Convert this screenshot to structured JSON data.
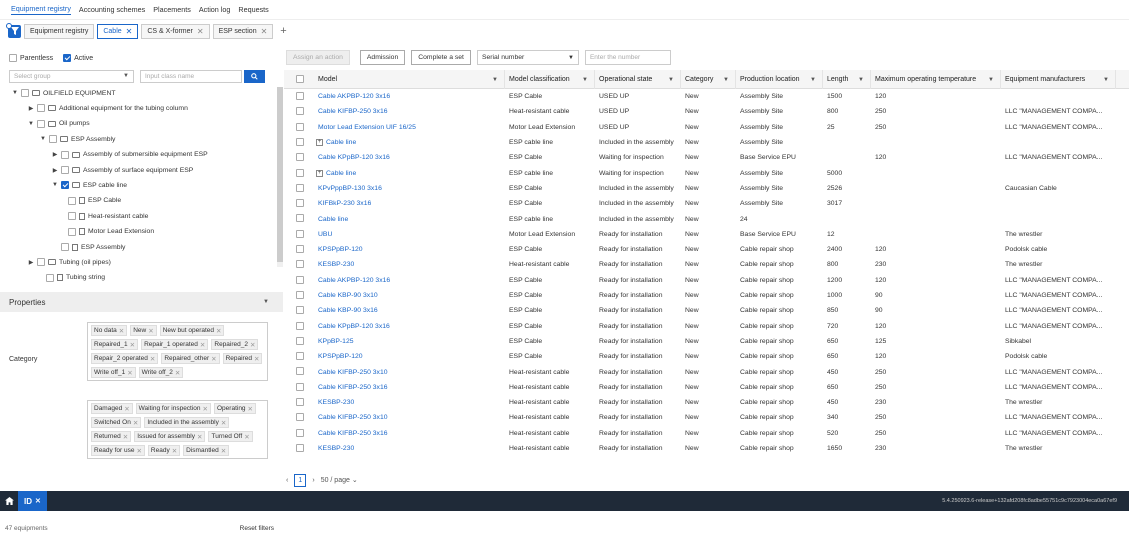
{
  "topnav": [
    "Equipment registry",
    "Accounting schemes",
    "Placements",
    "Action log",
    "Requests"
  ],
  "tabs": [
    {
      "label": "Equipment registry",
      "close": false,
      "active": false
    },
    {
      "label": "Cable",
      "close": true,
      "active": true
    },
    {
      "label": "CS & X-former",
      "close": true,
      "active": false
    },
    {
      "label": "ESP section",
      "close": true,
      "active": false
    }
  ],
  "filters": {
    "parentless": "Parentless",
    "active": "Active",
    "group_placeholder": "Select group",
    "class_placeholder": "Input class name"
  },
  "tree": [
    {
      "label": "OILFIELD EQUIPMENT",
      "level": 0,
      "caret": "▼",
      "checked": false,
      "icon": "folder"
    },
    {
      "label": "Additional equipment for the tubing column",
      "level": 1,
      "caret": "▶",
      "checked": false,
      "icon": "folder"
    },
    {
      "label": "Oil pumps",
      "level": 1,
      "caret": "▼",
      "checked": false,
      "icon": "folder"
    },
    {
      "label": "ESP Assembly",
      "level": 2,
      "caret": "▼",
      "checked": false,
      "icon": "folder"
    },
    {
      "label": "Assembly of submersible equipment ESP",
      "level": 3,
      "caret": "▶",
      "checked": false,
      "icon": "folder"
    },
    {
      "label": "Assembly of surface equipment ESP",
      "level": 3,
      "caret": "▶",
      "checked": false,
      "icon": "folder"
    },
    {
      "label": "ESP cable line",
      "level": 3,
      "caret": "▼",
      "checked": true,
      "icon": "folder"
    },
    {
      "label": "ESP Cable",
      "level": 4,
      "caret": "",
      "checked": false,
      "icon": "doc"
    },
    {
      "label": "Heat-resistant cable",
      "level": 4,
      "caret": "",
      "checked": false,
      "icon": "doc"
    },
    {
      "label": "Motor Lead Extension",
      "level": 4,
      "caret": "",
      "checked": false,
      "icon": "doc"
    },
    {
      "label": "ESP Assembly",
      "level": 2,
      "caret": "",
      "checked": false,
      "icon": "doc"
    },
    {
      "label": "Tubing (oil pipes)",
      "level": 0,
      "caret": "▶",
      "checked": false,
      "icon": "folder"
    },
    {
      "label": "Tubing string",
      "level": 0,
      "caret": "",
      "checked": false,
      "icon": "doc"
    }
  ],
  "properties": {
    "title": "Properties",
    "category_label": "Category",
    "category_tags": [
      "No data",
      "New",
      "New but operated",
      "Repaired_1",
      "Repair_1 operated",
      "Repaired_2",
      "Repair_2 operated",
      "Repaired_other",
      "Repaired",
      "Write off_1",
      "Write off_2"
    ],
    "state_tags": [
      "Damaged",
      "Waiting for inspection",
      "Operating",
      "Switched On",
      "Included in the assembly",
      "Returned",
      "Issued for assembly",
      "Turned Off",
      "Ready for use",
      "Ready",
      "Dismantled"
    ]
  },
  "left_footer": {
    "count": "47 equipments",
    "reset": "Reset filters"
  },
  "toolbar": {
    "assign": "Assign an action",
    "admission": "Admission",
    "complete": "Complete a set",
    "serial": "Serial number",
    "number_placeholder": "Enter the number"
  },
  "columns": [
    "Model",
    "Model classification",
    "Operational state",
    "Category",
    "Production location",
    "Length",
    "Maximum operating temperature",
    "Equipment manufacturers"
  ],
  "rows": [
    [
      "Cable AKPBP-120 3x16",
      "ESP Cable",
      "USED UP",
      "New",
      "Assembly Site",
      "1500",
      "120",
      ""
    ],
    [
      "Cable KIFBP-250 3x16",
      "Heat-resistant cable",
      "USED UP",
      "New",
      "Assembly Site",
      "800",
      "250",
      "LLC \"MANAGEMENT COMPA..."
    ],
    [
      "Motor Lead Extension UIF 16/25",
      "Motor Lead Extension",
      "USED UP",
      "New",
      "Assembly Site",
      "25",
      "250",
      "LLC \"MANAGEMENT COMPA..."
    ],
    [
      "Cable line",
      "ESP cable line",
      "Included in the assembly",
      "New",
      "Assembly Site",
      "",
      "",
      ""
    ],
    [
      "Cable KPpBP-120 3x16",
      "ESP Cable",
      "Waiting for inspection",
      "New",
      "Base Service EPU",
      "",
      "120",
      "LLC \"MANAGEMENT COMPA..."
    ],
    [
      "Cable line",
      "ESP cable line",
      "Waiting for inspection",
      "New",
      "Assembly Site",
      "5000",
      "",
      ""
    ],
    [
      "KPvPppBP-130 3x16",
      "ESP Cable",
      "Included in the assembly",
      "New",
      "Assembly Site",
      "2526",
      "",
      "Caucasian Cable"
    ],
    [
      "KIFBkP-230 3x16",
      "ESP Cable",
      "Included in the assembly",
      "New",
      "Assembly Site",
      "3017",
      "",
      ""
    ],
    [
      "Cable line",
      "ESP cable line",
      "Included in the assembly",
      "New",
      "24",
      "",
      "",
      ""
    ],
    [
      "UBU",
      "Motor Lead Extension",
      "Ready for installation",
      "New",
      "Base Service EPU",
      "12",
      "",
      "The wrestler"
    ],
    [
      "KPSPpBP-120",
      "ESP Cable",
      "Ready for installation",
      "New",
      "Cable repair shop",
      "2400",
      "120",
      "Podolsk cable"
    ],
    [
      "KESBP-230",
      "Heat-resistant cable",
      "Ready for installation",
      "New",
      "Cable repair shop",
      "800",
      "230",
      "The wrestler"
    ],
    [
      "Cable AKPBP-120 3x16",
      "ESP Cable",
      "Ready for installation",
      "New",
      "Cable repair shop",
      "1200",
      "120",
      "LLC \"MANAGEMENT COMPA..."
    ],
    [
      "Cable KBP-90 3x10",
      "ESP Cable",
      "Ready for installation",
      "New",
      "Cable repair shop",
      "1000",
      "90",
      "LLC \"MANAGEMENT COMPA..."
    ],
    [
      "Cable KBP-90 3x16",
      "ESP Cable",
      "Ready for installation",
      "New",
      "Cable repair shop",
      "850",
      "90",
      "LLC \"MANAGEMENT COMPA..."
    ],
    [
      "Cable KPpBP-120 3x16",
      "ESP Cable",
      "Ready for installation",
      "New",
      "Cable repair shop",
      "720",
      "120",
      "LLC \"MANAGEMENT COMPA..."
    ],
    [
      "KPpBP-125",
      "ESP Cable",
      "Ready for installation",
      "New",
      "Cable repair shop",
      "650",
      "125",
      "Sibkabel"
    ],
    [
      "KPSPpBP-120",
      "ESP Cable",
      "Ready for installation",
      "New",
      "Cable repair shop",
      "650",
      "120",
      "Podolsk cable"
    ],
    [
      "Cable KIFBP-250 3x10",
      "Heat-resistant cable",
      "Ready for installation",
      "New",
      "Cable repair shop",
      "450",
      "250",
      "LLC \"MANAGEMENT COMPA..."
    ],
    [
      "Cable KIFBP-250 3x16",
      "Heat-resistant cable",
      "Ready for installation",
      "New",
      "Cable repair shop",
      "650",
      "250",
      "LLC \"MANAGEMENT COMPA..."
    ],
    [
      "KESBP-230",
      "Heat-resistant cable",
      "Ready for installation",
      "New",
      "Cable repair shop",
      "450",
      "230",
      "The wrestler"
    ],
    [
      "Cable KIFBP-250 3x10",
      "Heat-resistant cable",
      "Ready for installation",
      "New",
      "Cable repair shop",
      "340",
      "250",
      "LLC \"MANAGEMENT COMPA..."
    ],
    [
      "Cable KIFBP-250 3x16",
      "Heat-resistant cable",
      "Ready for installation",
      "New",
      "Cable repair shop",
      "520",
      "250",
      "LLC \"MANAGEMENT COMPA..."
    ],
    [
      "KESBP-230",
      "Heat-resistant cable",
      "Ready for installation",
      "New",
      "Cable repair shop",
      "1650",
      "230",
      "The wrestler"
    ]
  ],
  "expandable_rows": [
    3,
    5
  ],
  "pager": {
    "page": "1",
    "per_page": "50 / page"
  },
  "statusbar": {
    "id": "ID",
    "version": "5.4.250923.6-release+132afd208fc8adbe55751c9c7923004eca0a67ef9"
  },
  "colors": {
    "accent": "#1a66c9",
    "statusbar": "#1f2a38"
  }
}
